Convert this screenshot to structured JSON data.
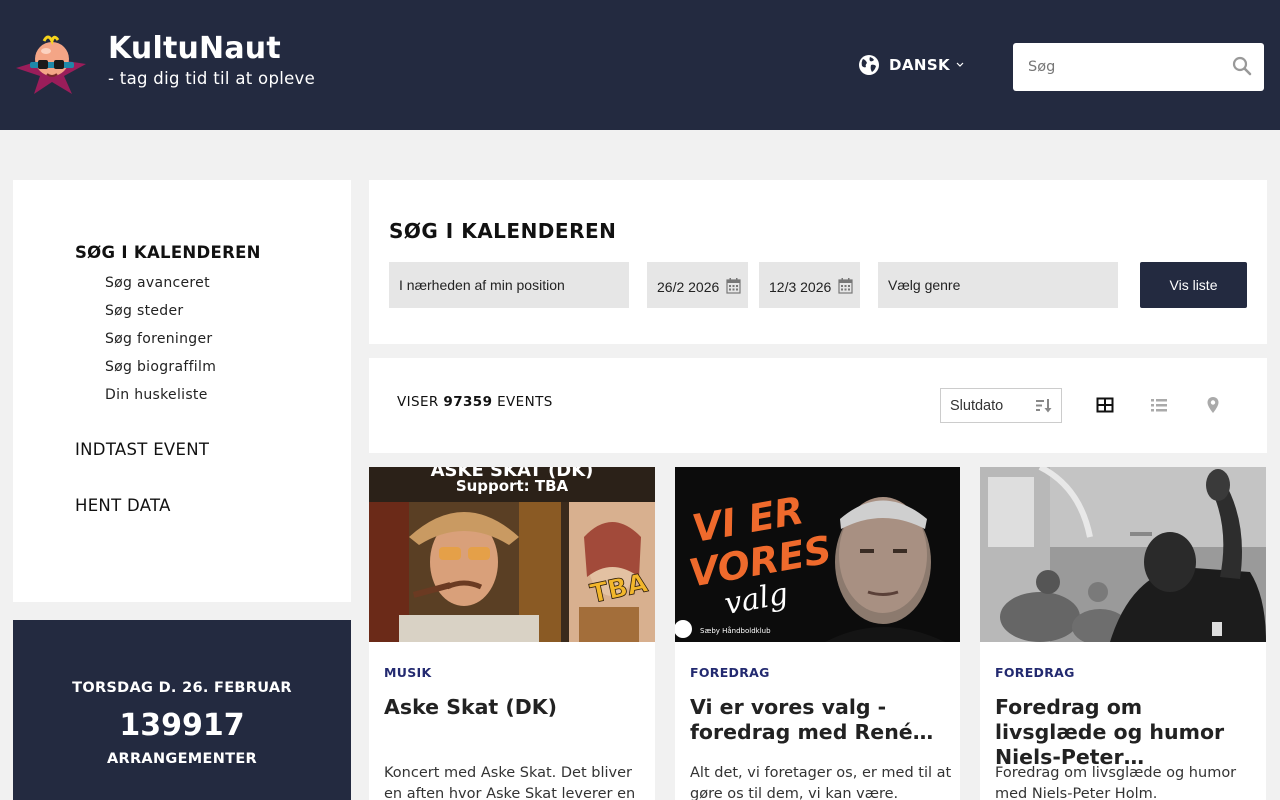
{
  "header": {
    "brand_title": "KultuNaut",
    "brand_tagline": "- tag dig tid til at opleve",
    "language_label": "DANSK",
    "search_placeholder": "Søg",
    "background_color": "#232a40"
  },
  "sidebar": {
    "heading": "SØG I KALENDEREN",
    "sub_items": [
      {
        "label": "Søg avanceret"
      },
      {
        "label": "Søg steder"
      },
      {
        "label": "Søg foreninger"
      },
      {
        "label": "Søg biograffilm"
      },
      {
        "label": "Din huskeliste"
      }
    ],
    "main_items": [
      {
        "label": "INDTAST EVENT"
      },
      {
        "label": "HENT DATA"
      }
    ]
  },
  "date_box": {
    "date_label": "TORSDAG D. 26. FEBRUAR",
    "count": "139917",
    "count_label": "ARRANGEMENTER"
  },
  "search_panel": {
    "title": "SØG I KALENDEREN",
    "location_value": "I nærheden af min position",
    "start_date": "26/2 2026",
    "end_date": "12/3 2026",
    "genre_placeholder": "Vælg genre",
    "submit_label": "Vis liste"
  },
  "results": {
    "prefix": "VISER",
    "count": "97359",
    "suffix": "EVENTS",
    "sort_value": "Slutdato",
    "views": [
      "grid-view-icon",
      "list-view-icon",
      "map-view-icon"
    ],
    "active_view": "grid-view-icon"
  },
  "cards": [
    {
      "category": "MUSIK",
      "title": "Aske Skat (DK)",
      "description": "Koncert med Aske Skat. Det bliver en aften hvor Aske Skat leverer en",
      "image_text_top": "ASKE SKAT (DK)",
      "image_text_support": "Support: TBA",
      "image_text_badge": "TBA"
    },
    {
      "category": "FOREDRAG",
      "title": "Vi er vores valg - foredrag med René…",
      "description": "Alt det, vi foretager os, er med til at gøre os til dem, vi kan være.",
      "image_text_1": "VI ER",
      "image_text_2": "VORES",
      "image_text_3": "valg",
      "image_text_sponsor": "Sæby Håndboldklub"
    },
    {
      "category": "FOREDRAG",
      "title": "Foredrag om livsglæde og humor Niels-Peter…",
      "description": "Foredrag om livsglæde og humor med Niels-Peter Holm."
    }
  ]
}
